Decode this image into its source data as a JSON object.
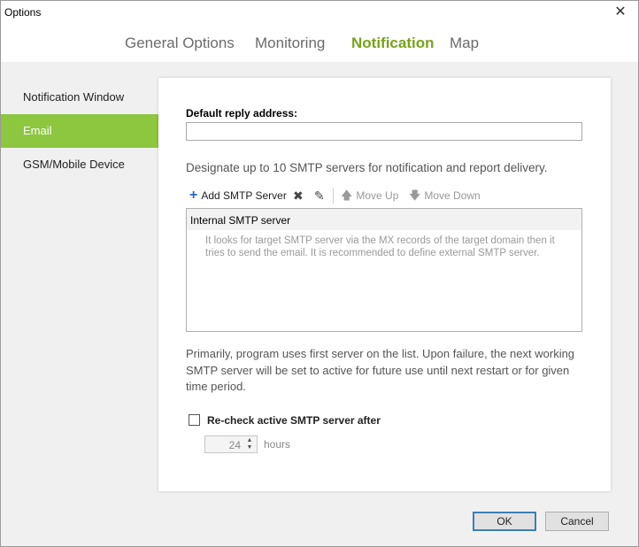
{
  "window": {
    "title": "Options"
  },
  "tabs": [
    {
      "label": "General Options"
    },
    {
      "label": "Monitoring"
    },
    {
      "label": "Notification"
    },
    {
      "label": "Map"
    }
  ],
  "sidebar": {
    "items": [
      {
        "label": "Notification Window"
      },
      {
        "label": "Email"
      },
      {
        "label": "GSM/Mobile Device"
      }
    ]
  },
  "email": {
    "reply_label": "Default reply address:",
    "reply_value": "",
    "designate_text": "Designate up to 10 SMTP servers for notification and report delivery.",
    "toolbar": {
      "add_label": "Add SMTP Server",
      "move_up_label": "Move Up",
      "move_down_label": "Move Down"
    },
    "servers": [
      {
        "name": "Internal SMTP server",
        "description": "It looks for target SMTP server via the MX records of the target domain then it tries to send the email. It is recommended to define external SMTP server."
      }
    ],
    "note": "Primarily, program uses first server on the list. Upon failure, the next working SMTP server will be set to active for future use until next restart or for given time period.",
    "recheck_label": "Re-check active SMTP server after",
    "recheck_checked": false,
    "recheck_hours": "24",
    "hours_label": "hours"
  },
  "buttons": {
    "ok": "OK",
    "cancel": "Cancel"
  },
  "colors": {
    "accent": "#8dc63f",
    "tab_active": "#76a31a",
    "add_icon": "#2c69c5"
  }
}
